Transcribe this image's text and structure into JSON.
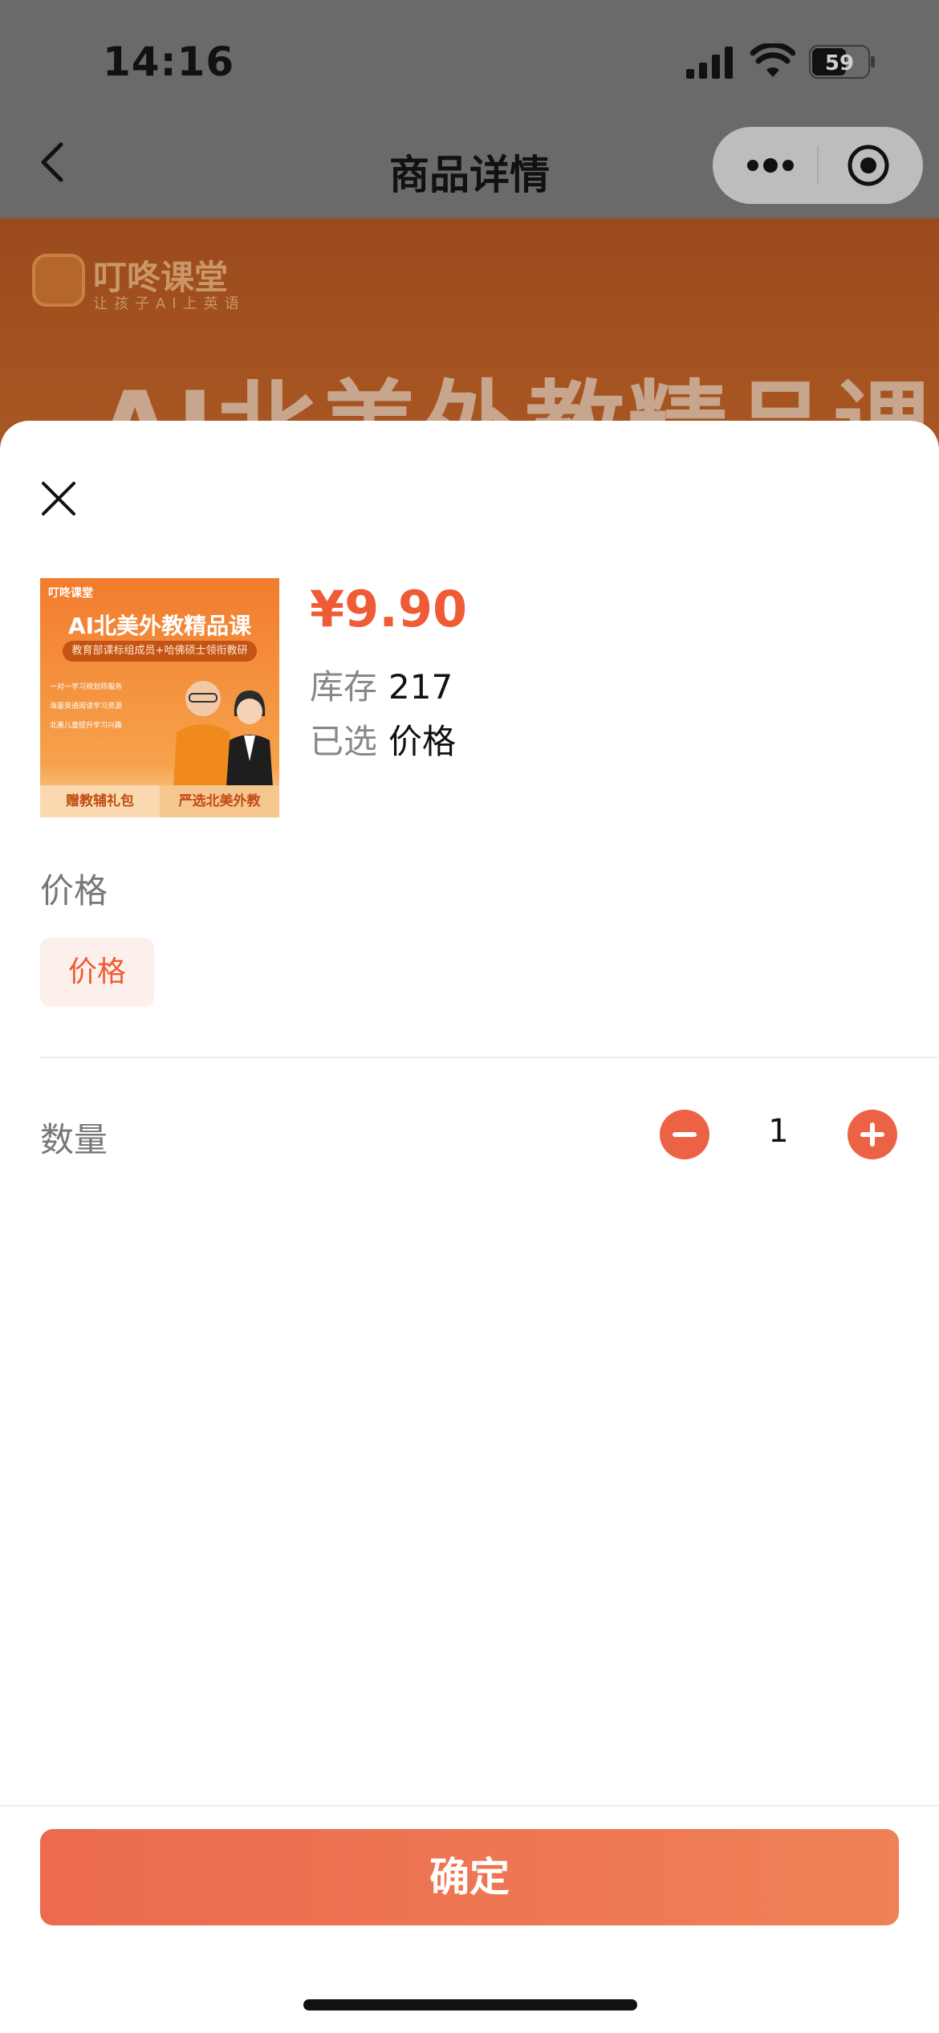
{
  "status_bar": {
    "time": "14:16",
    "battery": "59"
  },
  "nav": {
    "title": "商品详情"
  },
  "banner": {
    "brand": "叮咚课堂",
    "slogan": "让孩子AI上英语",
    "title": "AI北美外教精品课"
  },
  "product": {
    "thumb_brand": "叮咚课堂",
    "thumb_title": "AI北美外教精品课",
    "thumb_subtitle": "教育部课标组成员+哈佛硕士领衔教研",
    "thumb_bullets": [
      "一对一学习规划师服务",
      "海量英语阅读学习资源",
      "北美儿童提升学习兴趣"
    ],
    "thumb_footer_left": "赠教辅礼包",
    "thumb_footer_right": "严选北美外教",
    "price": "¥9.90",
    "stock_label": "库存",
    "stock_value": "217",
    "selected_label": "已选",
    "selected_value": "价格"
  },
  "spec": {
    "label": "价格",
    "options": [
      "价格"
    ]
  },
  "quantity": {
    "label": "数量",
    "value": "1"
  },
  "confirm_label": "确定",
  "colors": {
    "accent": "#ee5b35",
    "chip_bg": "#fdf0ec",
    "button_start": "#ec6a4e",
    "button_end": "#ef8156"
  }
}
